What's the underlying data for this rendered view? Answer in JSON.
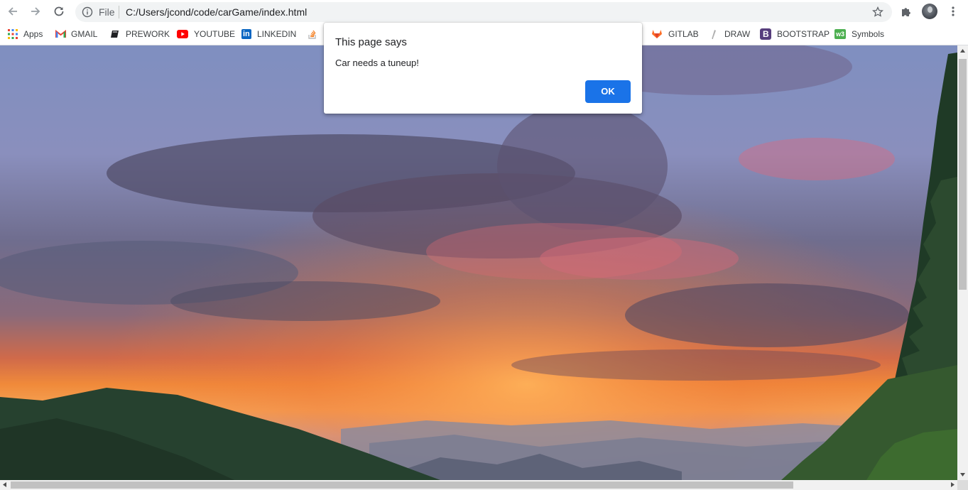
{
  "toolbar": {
    "file_label": "File",
    "url": "C:/Users/jcond/code/carGame/index.html"
  },
  "bookmarks": [
    {
      "label": "Apps",
      "icon": "apps-grid-icon"
    },
    {
      "label": "GMAIL",
      "icon": "gmail-icon"
    },
    {
      "label": "PREWORK",
      "icon": "book-icon"
    },
    {
      "label": "YOUTUBE",
      "icon": "youtube-icon"
    },
    {
      "label": "LINKEDIN",
      "icon": "linkedin-icon"
    },
    {
      "label": "",
      "icon": "stack-overflow-icon"
    },
    {
      "label": "GITLAB",
      "icon": "gitlab-icon"
    },
    {
      "label": "DRAW",
      "icon": "pencil-icon"
    },
    {
      "label": "BOOTSTRAP",
      "icon": "bootstrap-icon"
    },
    {
      "label": "Symbols",
      "icon": "w3-icon"
    }
  ],
  "dialog": {
    "title": "This page says",
    "message": "Car needs a tuneup!",
    "ok_label": "OK"
  },
  "colors": {
    "accent": "#1a73e8",
    "omnibox_bg": "#f1f3f4"
  }
}
